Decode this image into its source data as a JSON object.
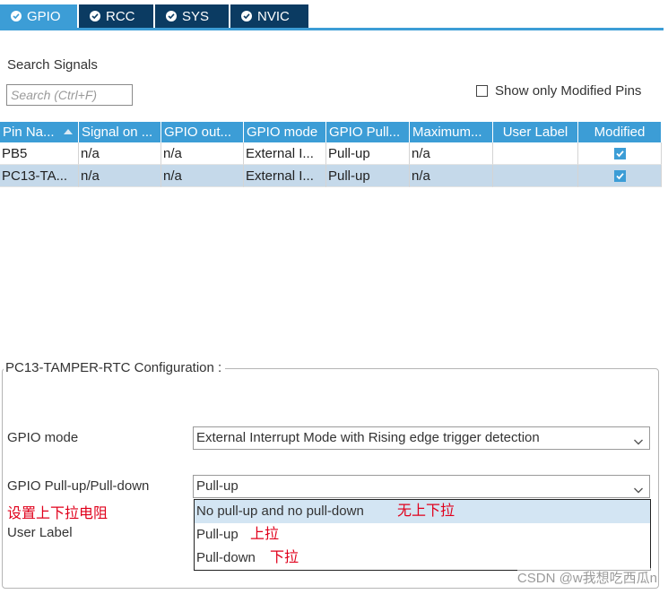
{
  "tabs": [
    {
      "label": "GPIO",
      "active": true
    },
    {
      "label": "RCC",
      "active": false
    },
    {
      "label": "SYS",
      "active": false
    },
    {
      "label": "NVIC",
      "active": false
    }
  ],
  "search": {
    "title": "Search Signals",
    "placeholder": "Search (Ctrl+F)",
    "value": ""
  },
  "modified_filter": {
    "label": "Show only Modified Pins",
    "checked": false
  },
  "table": {
    "headers": [
      "Pin Na...",
      "Signal on ...",
      "GPIO out...",
      "GPIO mode",
      "GPIO Pull...",
      "Maximum...",
      "User Label",
      "Modified"
    ],
    "rows": [
      {
        "cells": [
          "PB5",
          "n/a",
          "n/a",
          "External I...",
          "Pull-up",
          "n/a",
          ""
        ],
        "modified": true,
        "selected": false
      },
      {
        "cells": [
          "PC13-TA...",
          "n/a",
          "n/a",
          "External I...",
          "Pull-up",
          "n/a",
          ""
        ],
        "modified": true,
        "selected": true
      }
    ]
  },
  "config": {
    "title": "PC13-TAMPER-RTC Configuration :",
    "gpio_mode_label": "GPIO mode",
    "gpio_mode_value": "External Interrupt Mode with Rising edge trigger detection",
    "pull_label": "GPIO Pull-up/Pull-down",
    "pull_value": "Pull-up",
    "pull_annotation": "设置上下拉电阻",
    "user_label_label": "User Label"
  },
  "pull_options": [
    {
      "label": "No pull-up and no pull-down",
      "annotation": "无上下拉",
      "highlighted": true
    },
    {
      "label": "Pull-up",
      "annotation": "上拉",
      "highlighted": false
    },
    {
      "label": "Pull-down",
      "annotation": "下拉",
      "highlighted": false
    }
  ],
  "watermark": "CSDN @w我想吃西瓜n",
  "colors": {
    "tab_active": "#3c9dd6",
    "tab_inactive": "#0b3b62",
    "header_bg": "#3c9dd6",
    "selected_row": "#c5d9ea",
    "annotation": "#e0001b"
  },
  "icons": {
    "tab": "check-circle-icon",
    "dropdown": "chevron-down-icon",
    "sort": "sort-up-icon"
  }
}
